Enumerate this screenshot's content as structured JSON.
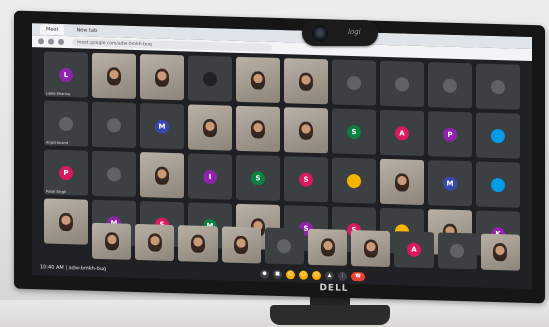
{
  "browser": {
    "tabs": [
      "Meet",
      "New tab"
    ],
    "url": "meet.google.com/adw-bmkh-buq"
  },
  "meeting": {
    "time_code": "10:40 AM | adw-bmkh-buq"
  },
  "monitor": {
    "brand": "DELL",
    "webcam_brand": "logi"
  },
  "participants": [
    {
      "name": "Lalita Sharma",
      "kind": "avatar",
      "letter": "L",
      "color": "#8e24aa"
    },
    {
      "name": "",
      "kind": "video"
    },
    {
      "name": "",
      "kind": "video"
    },
    {
      "name": "",
      "kind": "avatar",
      "letter": "",
      "color": "#202124"
    },
    {
      "name": "",
      "kind": "video"
    },
    {
      "name": "",
      "kind": "video"
    },
    {
      "name": "",
      "kind": "avatar",
      "letter": "",
      "color": "#5f6368"
    },
    {
      "name": "",
      "kind": "avatar",
      "letter": "",
      "color": "#5f6368"
    },
    {
      "name": "",
      "kind": "avatar",
      "letter": "",
      "color": "#5f6368"
    },
    {
      "name": "",
      "kind": "avatar",
      "letter": "",
      "color": "#5f6368"
    },
    {
      "name": "Anjali Anand",
      "kind": "avatar",
      "letter": "",
      "color": "#5f6368"
    },
    {
      "name": "",
      "kind": "avatar",
      "letter": "",
      "color": "#5f6368"
    },
    {
      "name": "",
      "kind": "avatar",
      "letter": "M",
      "color": "#3949ab"
    },
    {
      "name": "",
      "kind": "video"
    },
    {
      "name": "",
      "kind": "video"
    },
    {
      "name": "",
      "kind": "video"
    },
    {
      "name": "",
      "kind": "avatar",
      "letter": "S",
      "color": "#0b8043"
    },
    {
      "name": "",
      "kind": "avatar",
      "letter": "A",
      "color": "#d81b60"
    },
    {
      "name": "",
      "kind": "avatar",
      "letter": "P",
      "color": "#8e24aa"
    },
    {
      "name": "",
      "kind": "avatar",
      "letter": "",
      "color": "#039be5"
    },
    {
      "name": "Palak Singh",
      "kind": "avatar",
      "letter": "P",
      "color": "#d81b60"
    },
    {
      "name": "",
      "kind": "avatar",
      "letter": "",
      "color": "#5f6368"
    },
    {
      "name": "",
      "kind": "video"
    },
    {
      "name": "",
      "kind": "avatar",
      "letter": "I",
      "color": "#8e24aa"
    },
    {
      "name": "",
      "kind": "avatar",
      "letter": "S",
      "color": "#0b8043"
    },
    {
      "name": "",
      "kind": "avatar",
      "letter": "S",
      "color": "#d81b60"
    },
    {
      "name": "",
      "kind": "avatar",
      "letter": "",
      "color": "#f4b400"
    },
    {
      "name": "",
      "kind": "video"
    },
    {
      "name": "",
      "kind": "avatar",
      "letter": "M",
      "color": "#3949ab"
    },
    {
      "name": "",
      "kind": "avatar",
      "letter": "",
      "color": "#039be5"
    },
    {
      "name": "",
      "kind": "video"
    },
    {
      "name": "",
      "kind": "avatar",
      "letter": "M",
      "color": "#8e24aa"
    },
    {
      "name": "",
      "kind": "avatar",
      "letter": "S",
      "color": "#d81b60"
    },
    {
      "name": "",
      "kind": "avatar",
      "letter": "M",
      "color": "#0b8043"
    },
    {
      "name": "",
      "kind": "video"
    },
    {
      "name": "",
      "kind": "avatar",
      "letter": "S",
      "color": "#8e24aa"
    },
    {
      "name": "",
      "kind": "avatar",
      "letter": "S",
      "color": "#d81b60"
    },
    {
      "name": "",
      "kind": "avatar",
      "letter": "",
      "color": "#f4b400"
    },
    {
      "name": "",
      "kind": "video"
    },
    {
      "name": "",
      "kind": "avatar",
      "letter": "K",
      "color": "#8e24aa"
    }
  ],
  "last_row": [
    {
      "name": "",
      "kind": "video"
    },
    {
      "name": "",
      "kind": "video"
    },
    {
      "name": "",
      "kind": "video"
    },
    {
      "name": "",
      "kind": "video"
    },
    {
      "name": "",
      "kind": "avatar",
      "letter": "",
      "color": "#5f6368"
    },
    {
      "name": "",
      "kind": "video"
    },
    {
      "name": "",
      "kind": "video"
    },
    {
      "name": "",
      "kind": "avatar",
      "letter": "A",
      "color": "#d81b60"
    },
    {
      "name": "",
      "kind": "avatar",
      "letter": "",
      "color": "#5f6368"
    },
    {
      "name": "",
      "kind": "video"
    }
  ],
  "controls": {
    "mic": "mic-icon",
    "camera": "camera-icon",
    "reactions": "reaction-icon",
    "end_call": "end-call-icon"
  }
}
